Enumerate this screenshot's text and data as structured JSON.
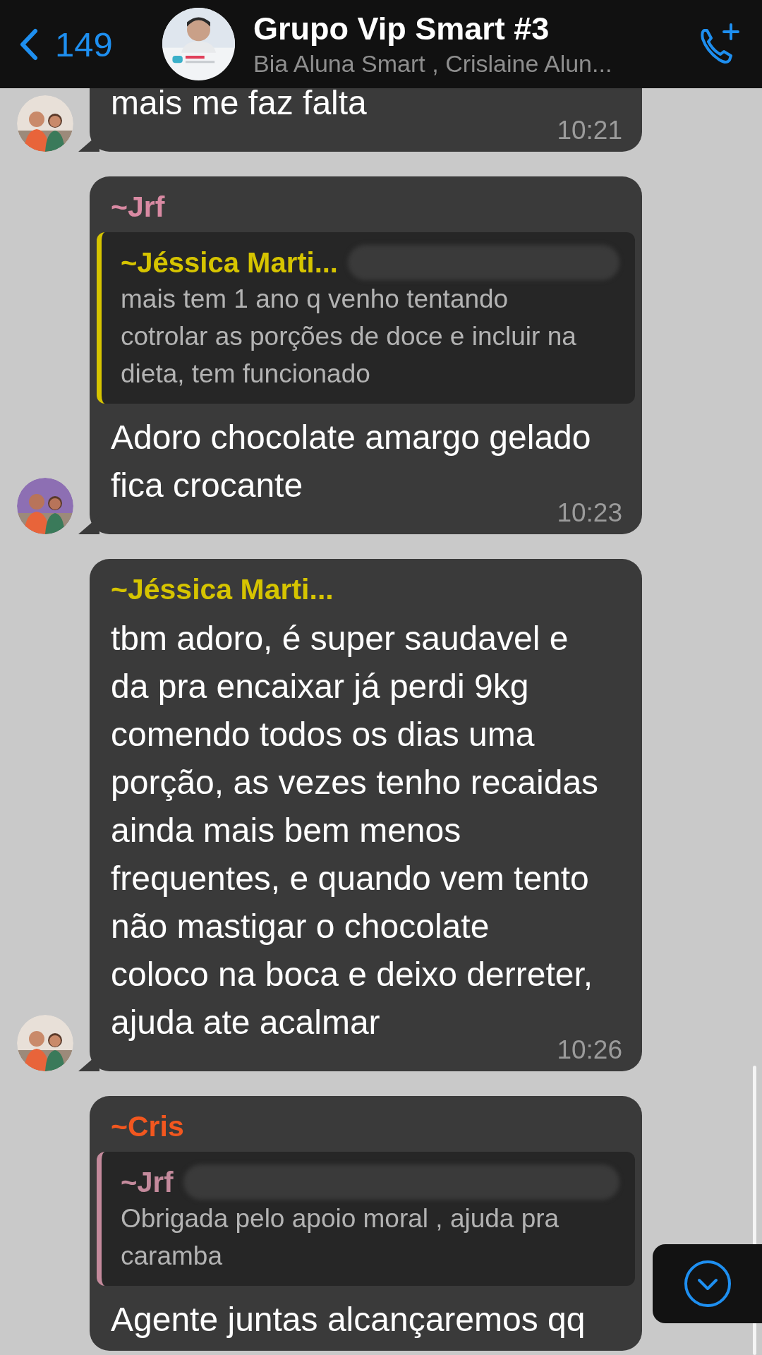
{
  "header": {
    "back_count": "149",
    "title": "Grupo Vip Smart #3",
    "subtitle": "Bia Aluna Smart , Crislaine Alun..."
  },
  "messages": [
    {
      "avatar": true,
      "lines": [
        "mais me faz falta"
      ],
      "time": "10:21"
    },
    {
      "avatar": true,
      "sender": "~Jrf",
      "color": "#d98aa3",
      "quote": {
        "sender": "~Jéssica Marti...",
        "color": "#d6c400",
        "redacted": true,
        "lines": [
          "mais tem 1 ano q venho tentando",
          "cotrolar as porções de doce e incluir na",
          "dieta, tem funcionado"
        ]
      },
      "lines": [
        "Adoro chocolate amargo gelado",
        "fica crocante"
      ],
      "time": "10:23"
    },
    {
      "avatar": true,
      "sender": "~Jéssica Marti...",
      "color": "#d6c400",
      "lines": [
        "tbm adoro, é super saudavel e",
        "da pra encaixar  já perdi 9kg",
        "comendo todos os dias uma",
        "porção,  as vezes tenho recaidas",
        "ainda mais bem menos",
        "frequentes, e quando vem tento",
        "não mastigar o chocolate",
        "coloco na boca e deixo derreter,",
        "ajuda ate acalmar"
      ],
      "time": "10:26"
    },
    {
      "avatar": false,
      "sender": "~Cris",
      "color": "#f2571f",
      "quote": {
        "sender": "~Jrf",
        "color": "#c48a9c",
        "redacted": true,
        "lines": [
          "Obrigada pelo apoio moral  , ajuda pra",
          "caramba"
        ]
      },
      "lines": [
        "Agente juntas alcançaremos qq"
      ]
    }
  ]
}
